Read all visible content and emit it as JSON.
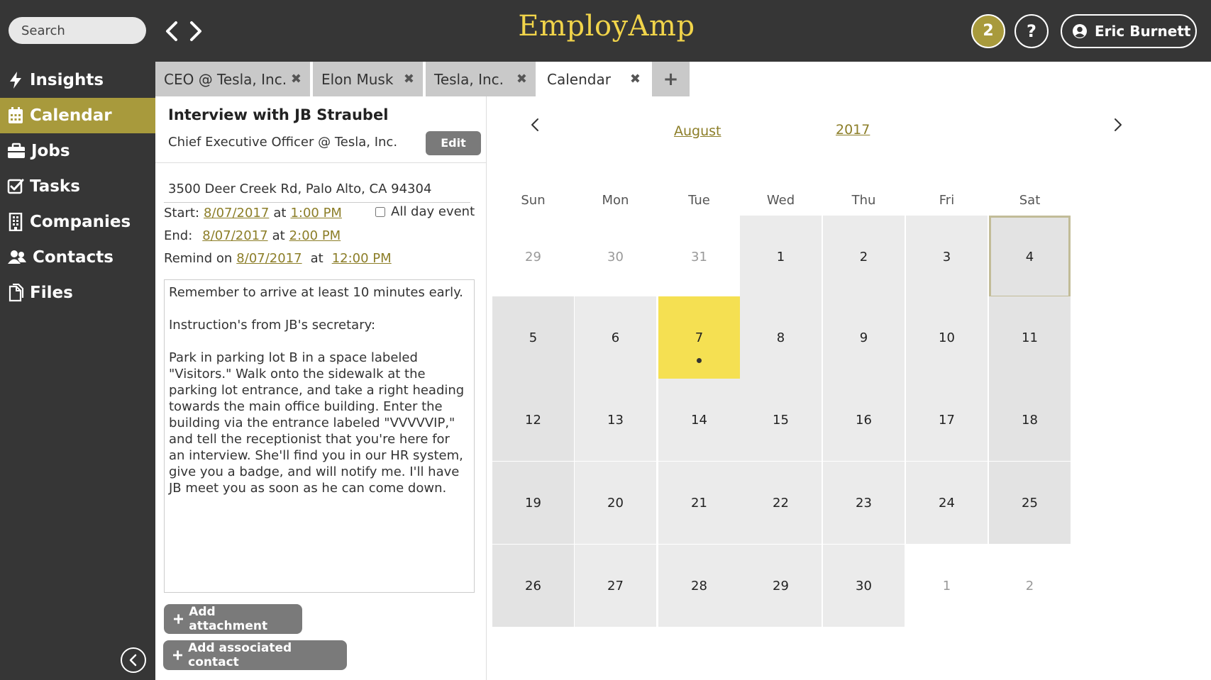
{
  "header": {
    "search_placeholder": "Search",
    "brand": "EmployAmp",
    "notification_count": "2",
    "help_label": "?",
    "user_name": "Eric Burnett",
    "brand_color": "#f1d44a",
    "accent_color": "#a89a3c"
  },
  "sidebar": {
    "items": [
      {
        "label": "Insights",
        "icon": "bolt-icon"
      },
      {
        "label": "Calendar",
        "icon": "calendar-icon"
      },
      {
        "label": "Jobs",
        "icon": "briefcase-icon"
      },
      {
        "label": "Tasks",
        "icon": "checkbox-icon"
      },
      {
        "label": "Companies",
        "icon": "building-icon"
      },
      {
        "label": "Contacts",
        "icon": "users-icon"
      },
      {
        "label": "Files",
        "icon": "files-icon"
      }
    ],
    "active": "Calendar"
  },
  "tabs": [
    {
      "label": "CEO @ Tesla, Inc.",
      "close": "✖"
    },
    {
      "label": "Elon Musk",
      "close": "✖"
    },
    {
      "label": "Tesla, Inc.",
      "close": "✖"
    },
    {
      "label": "Calendar",
      "close": "✖",
      "active": true
    }
  ],
  "add_tab_label": "+",
  "event": {
    "title": "Interview with JB Straubel",
    "subtitle": "Chief Executive Officer @ Tesla, Inc.",
    "edit_label": "Edit",
    "address": "3500 Deer Creek Rd, Palo Alto, CA 94304",
    "start_label": "Start:",
    "start_date": "8/07/2017",
    "start_time": "1:00 PM",
    "end_label": "End:",
    "end_date": "8/07/2017",
    "end_time": "2:00 PM",
    "remind_label": "Remind on",
    "remind_date": "8/07/2017",
    "remind_time": "12:00 PM",
    "at_label": "at",
    "all_day_label": "All day event",
    "all_day_checked": false,
    "notes": "Remember to arrive at least 10 minutes early.\n\nInstruction's from JB's secretary:\n\nPark in parking lot B in a space labeled \"Visitors.\" Walk onto the sidewalk at the parking lot entrance, and take a right heading towards the main office building. Enter the building via the entrance labeled \"VVVVVIP,\" and tell the receptionist that you're here for an interview. She'll find you in our HR system, give you a badge, and will notify me. I'll have JB meet you as soon as he can come down.",
    "add_attachment_label": "Add attachment",
    "add_contact_label": "Add associated contact"
  },
  "calendar": {
    "month": "August",
    "year": "2017",
    "weekdays": [
      "Sun",
      "Mon",
      "Tue",
      "Wed",
      "Thu",
      "Fri",
      "Sat"
    ],
    "days": [
      {
        "d": "29",
        "outside": true
      },
      {
        "d": "30",
        "outside": true
      },
      {
        "d": "31",
        "outside": true
      },
      {
        "d": "1"
      },
      {
        "d": "2"
      },
      {
        "d": "3"
      },
      {
        "d": "4",
        "selected": true
      },
      {
        "d": "5"
      },
      {
        "d": "6"
      },
      {
        "d": "7",
        "today": true,
        "event": true
      },
      {
        "d": "8"
      },
      {
        "d": "9"
      },
      {
        "d": "10"
      },
      {
        "d": "11"
      },
      {
        "d": "12"
      },
      {
        "d": "13"
      },
      {
        "d": "14"
      },
      {
        "d": "15"
      },
      {
        "d": "16"
      },
      {
        "d": "17"
      },
      {
        "d": "18"
      },
      {
        "d": "19"
      },
      {
        "d": "20"
      },
      {
        "d": "21"
      },
      {
        "d": "22"
      },
      {
        "d": "23"
      },
      {
        "d": "24"
      },
      {
        "d": "25"
      },
      {
        "d": "26"
      },
      {
        "d": "27"
      },
      {
        "d": "28"
      },
      {
        "d": "29"
      },
      {
        "d": "30"
      },
      {
        "d": "1",
        "outside": true
      },
      {
        "d": "2",
        "outside": true
      }
    ],
    "today_color": "#f5e052"
  }
}
